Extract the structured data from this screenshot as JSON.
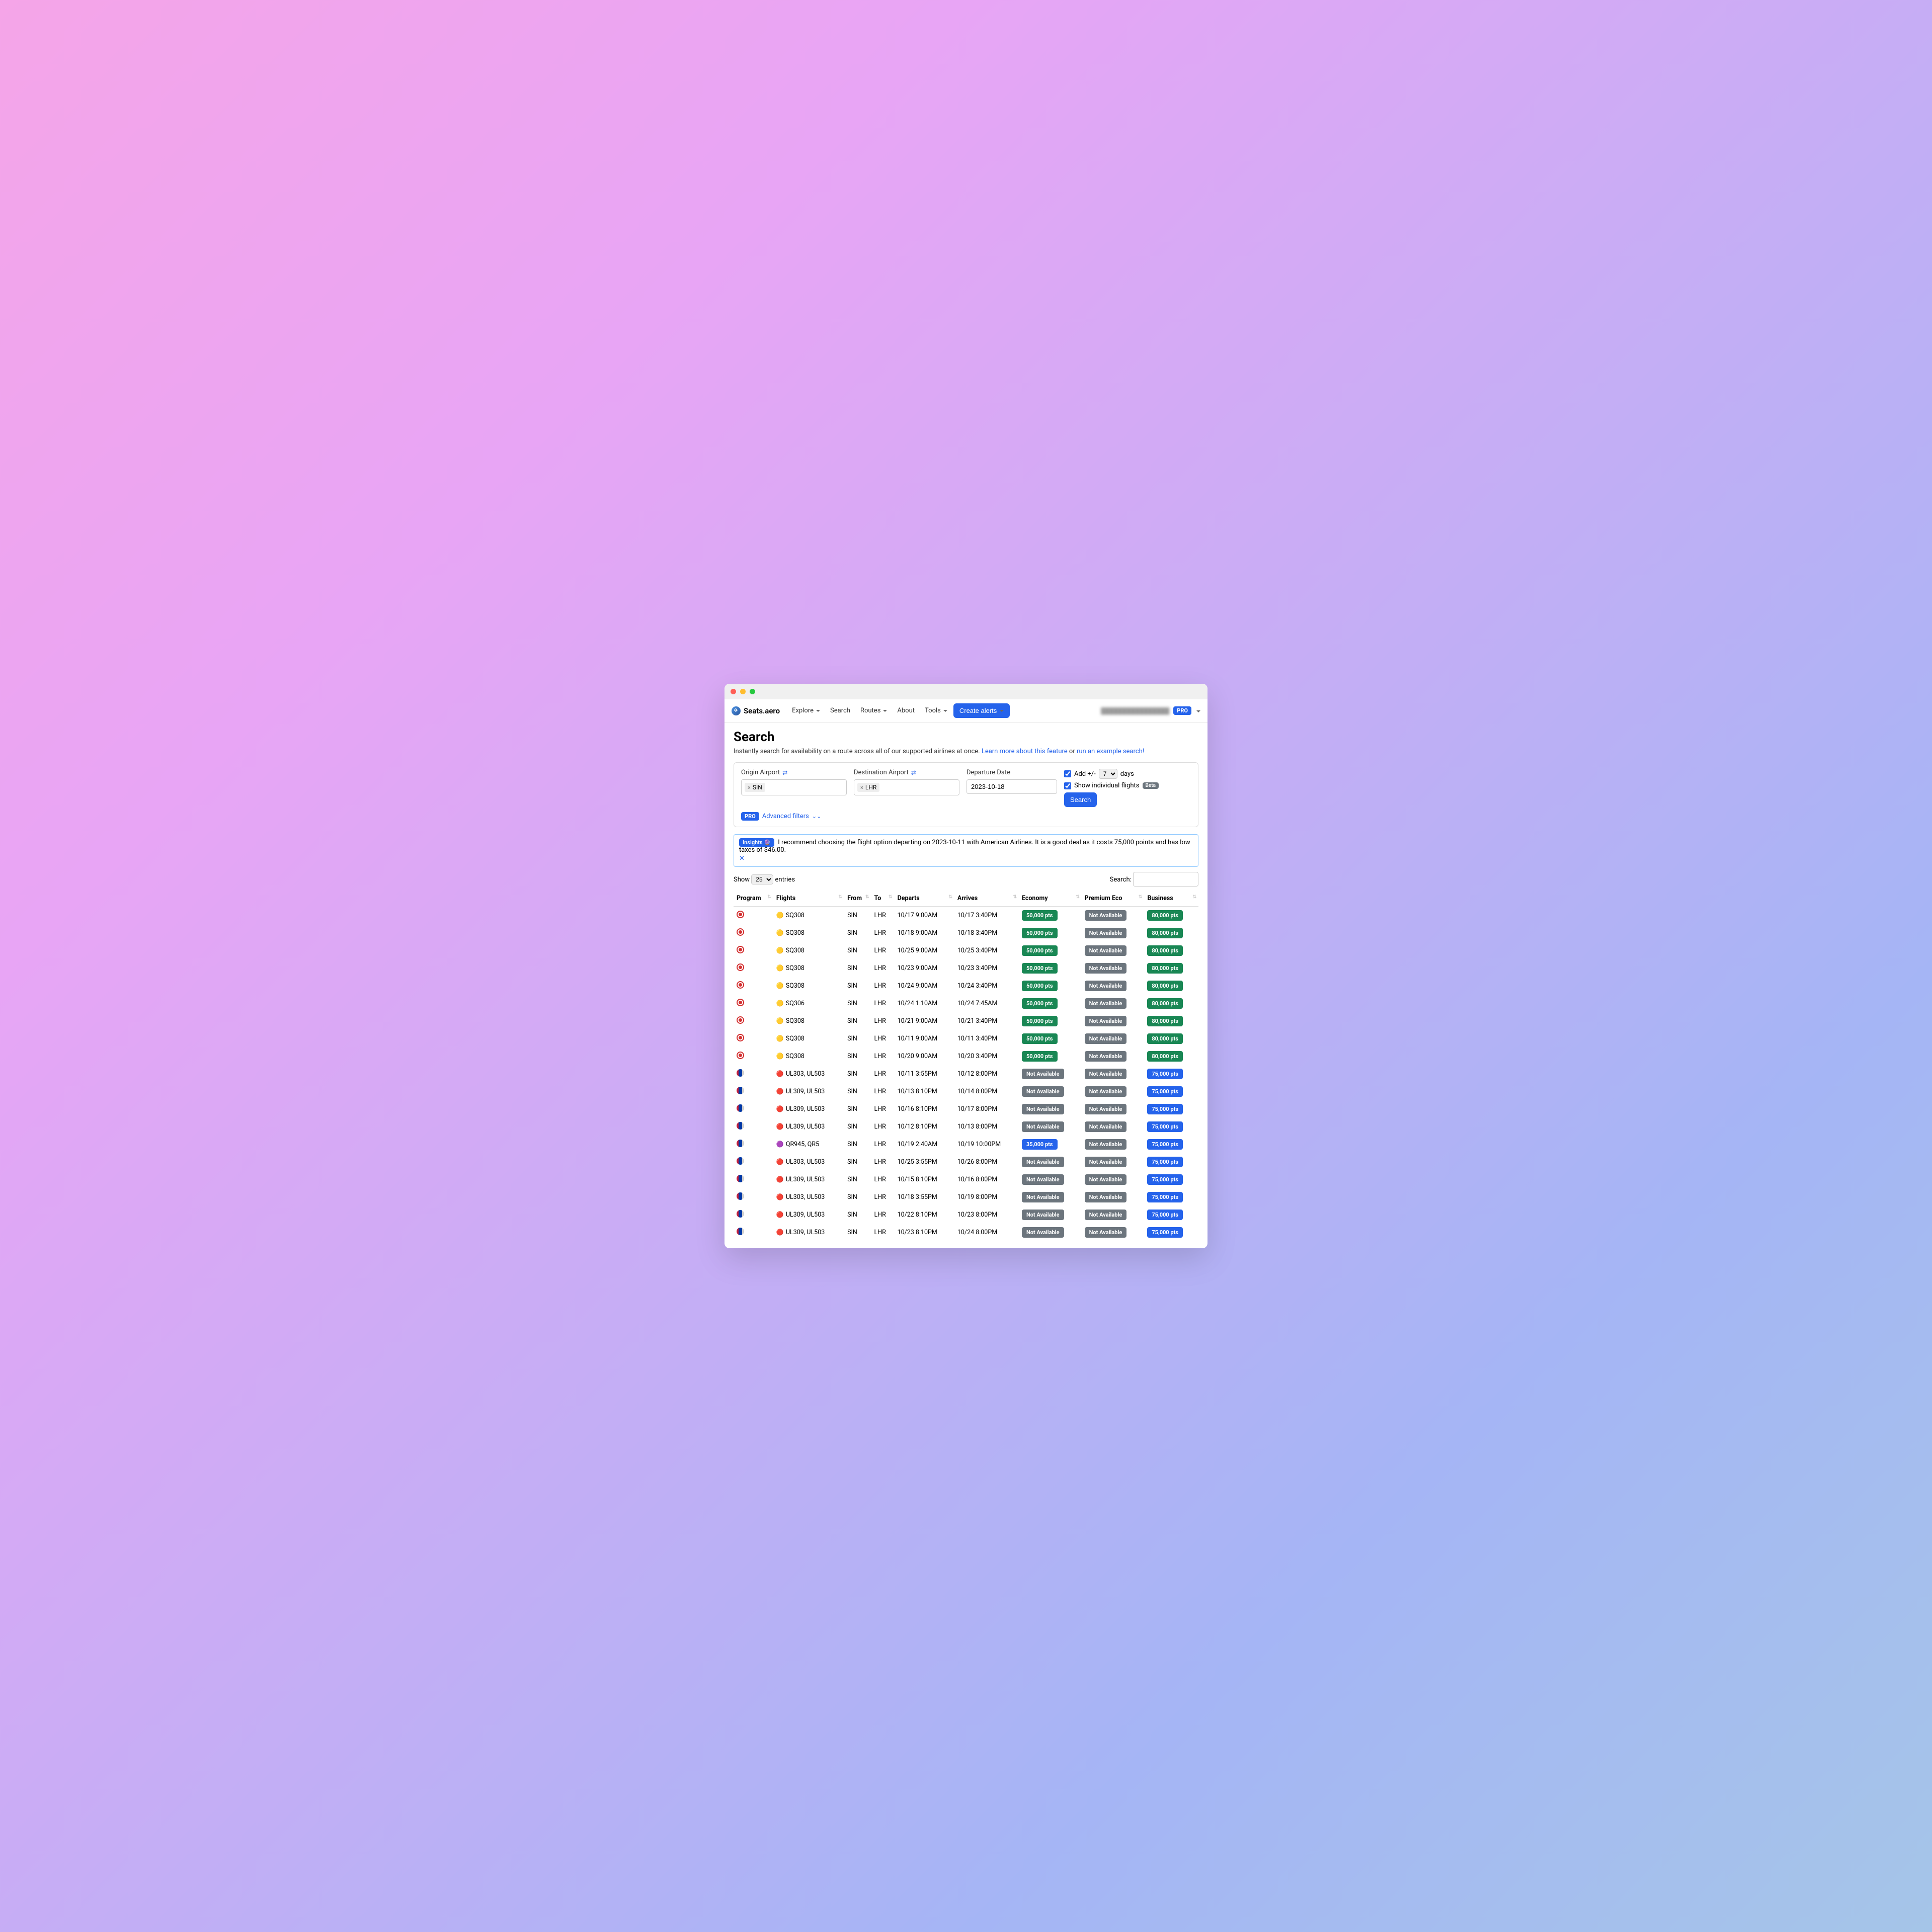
{
  "brand": "Seats.aero",
  "nav": {
    "explore": "Explore",
    "search": "Search",
    "routes": "Routes",
    "about": "About",
    "tools": "Tools",
    "create_alerts": "Create alerts",
    "pro": "PRO"
  },
  "page": {
    "title": "Search",
    "subtitle_a": "Instantly search for availability on a route across all of our supported airlines at once. ",
    "learn_more": "Learn more about this feature",
    "or": " or ",
    "example": "run an example search!"
  },
  "form": {
    "origin_label": "Origin Airport",
    "dest_label": "Destination Airport",
    "date_label": "Departure Date",
    "origin_tag": "SIN",
    "dest_tag": "LHR",
    "date_value": "2023-10-18",
    "add_days_a": "Add +/-",
    "add_days_b": "days",
    "days_value": "7",
    "show_individual": "Show individual flights",
    "beta": "Beta",
    "search_btn": "Search",
    "advanced": "Advanced filters",
    "pro": "PRO"
  },
  "insight": {
    "badge": "Insights 🔮",
    "text": "I recommend choosing the flight option departing on 2023-10-11 with American Airlines. It is a good deal as it costs 75,000 points and has low taxes of $46.00."
  },
  "table": {
    "show": "Show",
    "entries": "entries",
    "page_size": "25",
    "search_label": "Search:",
    "headers": {
      "program": "Program",
      "flights": "Flights",
      "from": "From",
      "to": "To",
      "departs": "Departs",
      "arrives": "Arrives",
      "economy": "Economy",
      "premium": "Premium Eco",
      "business": "Business"
    },
    "rows": [
      {
        "prog": "red",
        "air": "sq",
        "flights": "SQ308",
        "from": "SIN",
        "to": "LHR",
        "dep": "10/17 9:00AM",
        "arr": "10/17 3:40PM",
        "e": {
          "t": "50,000 pts",
          "c": "green"
        },
        "p": {
          "t": "Not Available",
          "c": "gray"
        },
        "b": {
          "t": "80,000 pts",
          "c": "green"
        }
      },
      {
        "prog": "red",
        "air": "sq",
        "flights": "SQ308",
        "from": "SIN",
        "to": "LHR",
        "dep": "10/18 9:00AM",
        "arr": "10/18 3:40PM",
        "e": {
          "t": "50,000 pts",
          "c": "green"
        },
        "p": {
          "t": "Not Available",
          "c": "gray"
        },
        "b": {
          "t": "80,000 pts",
          "c": "green"
        }
      },
      {
        "prog": "red",
        "air": "sq",
        "flights": "SQ308",
        "from": "SIN",
        "to": "LHR",
        "dep": "10/25 9:00AM",
        "arr": "10/25 3:40PM",
        "e": {
          "t": "50,000 pts",
          "c": "green"
        },
        "p": {
          "t": "Not Available",
          "c": "gray"
        },
        "b": {
          "t": "80,000 pts",
          "c": "green"
        }
      },
      {
        "prog": "red",
        "air": "sq",
        "flights": "SQ308",
        "from": "SIN",
        "to": "LHR",
        "dep": "10/23 9:00AM",
        "arr": "10/23 3:40PM",
        "e": {
          "t": "50,000 pts",
          "c": "green"
        },
        "p": {
          "t": "Not Available",
          "c": "gray"
        },
        "b": {
          "t": "80,000 pts",
          "c": "green"
        }
      },
      {
        "prog": "red",
        "air": "sq",
        "flights": "SQ308",
        "from": "SIN",
        "to": "LHR",
        "dep": "10/24 9:00AM",
        "arr": "10/24 3:40PM",
        "e": {
          "t": "50,000 pts",
          "c": "green"
        },
        "p": {
          "t": "Not Available",
          "c": "gray"
        },
        "b": {
          "t": "80,000 pts",
          "c": "green"
        }
      },
      {
        "prog": "red",
        "air": "sq",
        "flights": "SQ306",
        "from": "SIN",
        "to": "LHR",
        "dep": "10/24 1:10AM",
        "arr": "10/24 7:45AM",
        "e": {
          "t": "50,000 pts",
          "c": "green"
        },
        "p": {
          "t": "Not Available",
          "c": "gray"
        },
        "b": {
          "t": "80,000 pts",
          "c": "green"
        }
      },
      {
        "prog": "red",
        "air": "sq",
        "flights": "SQ308",
        "from": "SIN",
        "to": "LHR",
        "dep": "10/21 9:00AM",
        "arr": "10/21 3:40PM",
        "e": {
          "t": "50,000 pts",
          "c": "green"
        },
        "p": {
          "t": "Not Available",
          "c": "gray"
        },
        "b": {
          "t": "80,000 pts",
          "c": "green"
        }
      },
      {
        "prog": "red",
        "air": "sq",
        "flights": "SQ308",
        "from": "SIN",
        "to": "LHR",
        "dep": "10/11 9:00AM",
        "arr": "10/11 3:40PM",
        "e": {
          "t": "50,000 pts",
          "c": "green"
        },
        "p": {
          "t": "Not Available",
          "c": "gray"
        },
        "b": {
          "t": "80,000 pts",
          "c": "green"
        }
      },
      {
        "prog": "red",
        "air": "sq",
        "flights": "SQ308",
        "from": "SIN",
        "to": "LHR",
        "dep": "10/20 9:00AM",
        "arr": "10/20 3:40PM",
        "e": {
          "t": "50,000 pts",
          "c": "green"
        },
        "p": {
          "t": "Not Available",
          "c": "gray"
        },
        "b": {
          "t": "80,000 pts",
          "c": "green"
        }
      },
      {
        "prog": "aa",
        "air": "ul",
        "flights": "UL303, UL503",
        "from": "SIN",
        "to": "LHR",
        "dep": "10/11 3:55PM",
        "arr": "10/12 8:00PM",
        "e": {
          "t": "Not Available",
          "c": "gray"
        },
        "p": {
          "t": "Not Available",
          "c": "gray"
        },
        "b": {
          "t": "75,000 pts",
          "c": "blue"
        }
      },
      {
        "prog": "aa",
        "air": "ul",
        "flights": "UL309, UL503",
        "from": "SIN",
        "to": "LHR",
        "dep": "10/13 8:10PM",
        "arr": "10/14 8:00PM",
        "e": {
          "t": "Not Available",
          "c": "gray"
        },
        "p": {
          "t": "Not Available",
          "c": "gray"
        },
        "b": {
          "t": "75,000 pts",
          "c": "blue"
        }
      },
      {
        "prog": "aa",
        "air": "ul",
        "flights": "UL309, UL503",
        "from": "SIN",
        "to": "LHR",
        "dep": "10/16 8:10PM",
        "arr": "10/17 8:00PM",
        "e": {
          "t": "Not Available",
          "c": "gray"
        },
        "p": {
          "t": "Not Available",
          "c": "gray"
        },
        "b": {
          "t": "75,000 pts",
          "c": "blue"
        }
      },
      {
        "prog": "aa",
        "air": "ul",
        "flights": "UL309, UL503",
        "from": "SIN",
        "to": "LHR",
        "dep": "10/12 8:10PM",
        "arr": "10/13 8:00PM",
        "e": {
          "t": "Not Available",
          "c": "gray"
        },
        "p": {
          "t": "Not Available",
          "c": "gray"
        },
        "b": {
          "t": "75,000 pts",
          "c": "blue"
        }
      },
      {
        "prog": "aa",
        "air": "qr",
        "flights": "QR945, QR5",
        "from": "SIN",
        "to": "LHR",
        "dep": "10/19 2:40AM",
        "arr": "10/19 10:00PM",
        "e": {
          "t": "35,000 pts",
          "c": "blue"
        },
        "p": {
          "t": "Not Available",
          "c": "gray"
        },
        "b": {
          "t": "75,000 pts",
          "c": "blue"
        }
      },
      {
        "prog": "aa",
        "air": "ul",
        "flights": "UL303, UL503",
        "from": "SIN",
        "to": "LHR",
        "dep": "10/25 3:55PM",
        "arr": "10/26 8:00PM",
        "e": {
          "t": "Not Available",
          "c": "gray"
        },
        "p": {
          "t": "Not Available",
          "c": "gray"
        },
        "b": {
          "t": "75,000 pts",
          "c": "blue"
        }
      },
      {
        "prog": "aa",
        "air": "ul",
        "flights": "UL309, UL503",
        "from": "SIN",
        "to": "LHR",
        "dep": "10/15 8:10PM",
        "arr": "10/16 8:00PM",
        "e": {
          "t": "Not Available",
          "c": "gray"
        },
        "p": {
          "t": "Not Available",
          "c": "gray"
        },
        "b": {
          "t": "75,000 pts",
          "c": "blue"
        }
      },
      {
        "prog": "aa",
        "air": "ul",
        "flights": "UL303, UL503",
        "from": "SIN",
        "to": "LHR",
        "dep": "10/18 3:55PM",
        "arr": "10/19 8:00PM",
        "e": {
          "t": "Not Available",
          "c": "gray"
        },
        "p": {
          "t": "Not Available",
          "c": "gray"
        },
        "b": {
          "t": "75,000 pts",
          "c": "blue"
        }
      },
      {
        "prog": "aa",
        "air": "ul",
        "flights": "UL309, UL503",
        "from": "SIN",
        "to": "LHR",
        "dep": "10/22 8:10PM",
        "arr": "10/23 8:00PM",
        "e": {
          "t": "Not Available",
          "c": "gray"
        },
        "p": {
          "t": "Not Available",
          "c": "gray"
        },
        "b": {
          "t": "75,000 pts",
          "c": "blue"
        }
      },
      {
        "prog": "aa",
        "air": "ul",
        "flights": "UL309, UL503",
        "from": "SIN",
        "to": "LHR",
        "dep": "10/23 8:10PM",
        "arr": "10/24 8:00PM",
        "e": {
          "t": "Not Available",
          "c": "gray"
        },
        "p": {
          "t": "Not Available",
          "c": "gray"
        },
        "b": {
          "t": "75,000 pts",
          "c": "blue"
        }
      }
    ]
  }
}
